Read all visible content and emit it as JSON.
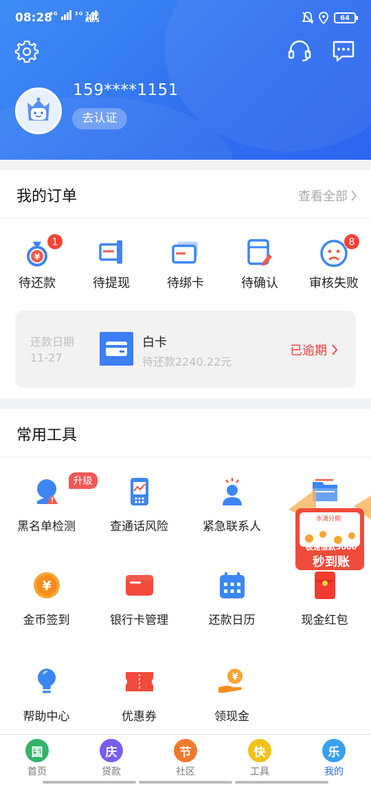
{
  "status_bar": {
    "time": "08:28",
    "network": "4G",
    "network2": "3G",
    "speed_value": "3.00",
    "speed_unit": "KB/S",
    "battery": "64"
  },
  "header": {
    "phone": "159****1151",
    "verify_label": "去认证"
  },
  "orders": {
    "title": "我的订单",
    "see_all": "查看全部",
    "items": [
      {
        "label": "待还款",
        "icon": "money-bag-icon",
        "badge": "1"
      },
      {
        "label": "待提现",
        "icon": "withdraw-icon",
        "badge": ""
      },
      {
        "label": "待绑卡",
        "icon": "bind-card-icon",
        "badge": ""
      },
      {
        "label": "待确认",
        "icon": "confirm-doc-icon",
        "badge": ""
      },
      {
        "label": "审核失败",
        "icon": "sad-face-icon",
        "badge": "8"
      }
    ],
    "repay": {
      "date_label": "还款日期",
      "date": "11-27",
      "card_name": "白卡",
      "amount_text": "待还款2240.22元",
      "status": "已逾期"
    }
  },
  "tools": {
    "title": "常用工具",
    "items": [
      {
        "label": "黑名单检测",
        "icon": "blacklist-check-icon"
      },
      {
        "label": "查通话风险",
        "icon": "phone-risk-icon"
      },
      {
        "label": "紧急联系人",
        "icon": "emergency-contact-icon"
      },
      {
        "label": "",
        "icon": "folder-icon"
      },
      {
        "label": "金币签到",
        "icon": "coin-checkin-icon"
      },
      {
        "label": "银行卡管理",
        "icon": "bank-card-icon"
      },
      {
        "label": "还款日历",
        "icon": "calendar-icon"
      },
      {
        "label": "现金红包",
        "icon": "red-envelope-icon"
      },
      {
        "label": "帮助中心",
        "icon": "help-bulb-icon"
      },
      {
        "label": "优惠券",
        "icon": "coupon-icon"
      },
      {
        "label": "领现金",
        "icon": "hand-coin-icon"
      }
    ],
    "upgrade_badge": "升级",
    "promo": {
      "brand": "水滴分期",
      "line1": "极速借款5000",
      "line2": "秒到账"
    }
  },
  "nav": {
    "items": [
      {
        "label": "首页",
        "glyph": "国",
        "color": "#35b36b"
      },
      {
        "label": "贷款",
        "glyph": "庆",
        "color": "#7b5cf0"
      },
      {
        "label": "社区",
        "glyph": "节",
        "color": "#f07a2c"
      },
      {
        "label": "工具",
        "glyph": "快",
        "color": "#f2c21b"
      },
      {
        "label": "我的",
        "glyph": "乐",
        "color": "#3aa0f0"
      }
    ],
    "active_index": 4
  },
  "colors": {
    "primary": "#2f6ff0",
    "alert": "#f23b3b",
    "badge": "#f44336"
  }
}
